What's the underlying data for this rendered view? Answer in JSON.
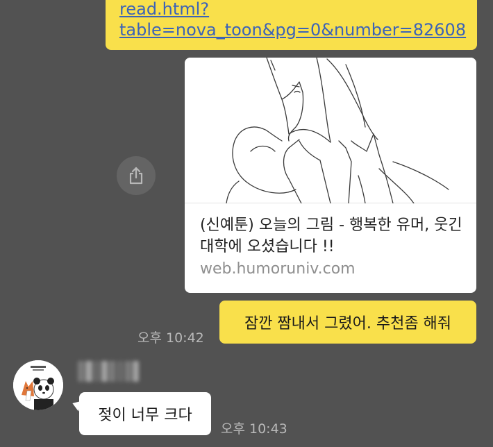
{
  "messages": {
    "link": {
      "line1": "read.html?",
      "line2": "table=nova_toon&pg=0&number=82608"
    },
    "preview": {
      "title": "(신예툰) 오늘의 그림 - 행복한 유머, 웃긴대학에 오셨습니다 !!",
      "domain": "web.humoruniv.com"
    },
    "mine": {
      "text": "잠깐 짬내서 그렸어. 추천좀 해줘",
      "time": "오후 10:42"
    },
    "other": {
      "text": "젖이 너무 크다",
      "time": "오후 10:43"
    }
  },
  "icons": {
    "share": "share-icon",
    "avatar": "fox-panda-avatar"
  },
  "colors": {
    "background": "#525252",
    "my_bubble": "#F9E04B",
    "other_bubble": "#ffffff",
    "link": "#3b63b8"
  }
}
